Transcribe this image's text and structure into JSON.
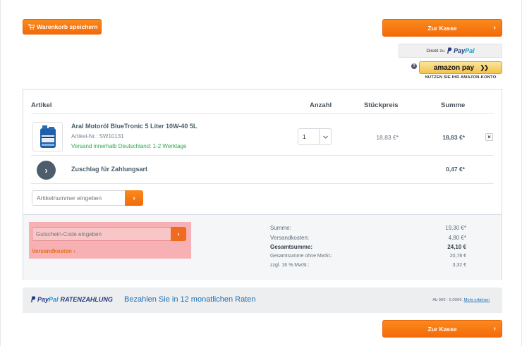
{
  "header": {
    "save_cart_label": "Warenkorb speichern",
    "checkout_label": "Zur Kasse",
    "paypal_direct_prefix": "Direkt zu",
    "paypal_brand_pay": "Pay",
    "paypal_brand_pal": "Pal",
    "amazon_pay_label": "amazon pay",
    "amazon_note": "NUTZEN SIE IHR AMAZON-KONTO",
    "help_glyph": "?"
  },
  "table_headers": {
    "article": "Artikel",
    "quantity": "Anzahl",
    "unit_price": "Stückpreis",
    "total": "Summe"
  },
  "items": [
    {
      "name": "Aral Motoröl BlueTronic 5 Liter 10W-40 5L",
      "sku": "Artikel-Nr.: SW10131",
      "shipping": "Versand innerhalb Deutschland: 1-2 Werktage",
      "quantity": "1",
      "unit_price": "18,83 €*",
      "total": "18,83 €*"
    }
  ],
  "surcharge": {
    "label": "Zuschlag für Zahlungsart",
    "total": "0,47 €*"
  },
  "article_number": {
    "placeholder": "Artikelnummer eingeben"
  },
  "voucher": {
    "placeholder": "Gutschein-Code eingeben",
    "shipping_link": "Versandkosten ›"
  },
  "totals": [
    {
      "label": "Summe:",
      "value": "19,30 €*"
    },
    {
      "label": "Versandkosten:",
      "value": "4,80 €*"
    },
    {
      "label": "Gesamtsumme:",
      "value": "24,10 €"
    },
    {
      "label": "Gesamtsumme ohne MwSt.:",
      "value": "20,78 €"
    },
    {
      "label": "zzgl. 16 % MwSt.:",
      "value": "3,32 €"
    }
  ],
  "paypal_installments": {
    "brand_pay": "Pay",
    "brand_pal": "Pal",
    "brand_suffix": "RATENZAHLUNG",
    "text": "Bezahlen Sie in 12 monatlichen Raten",
    "range": "Ab 99€ - 5.000€.",
    "link": "Mehr erfahren"
  },
  "colors": {
    "accent_orange": "#f46a0a",
    "ship_green": "#2fa84f",
    "paypal_blue": "#253b80",
    "highlight_pink": "#f7b1b4"
  }
}
